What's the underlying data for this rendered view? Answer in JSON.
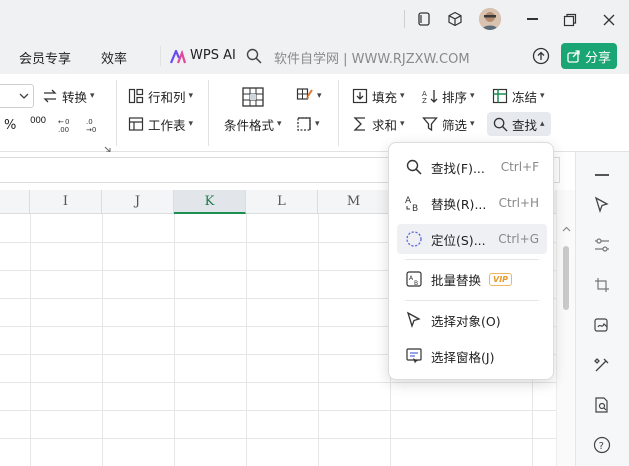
{
  "menubar": {
    "member": "会员专享",
    "efficiency": "效率",
    "wps_ai": "WPS AI",
    "search_text": "软件自学网 | WWW.RJZXW.COM",
    "share": "分享"
  },
  "ribbon": {
    "convert": "转换",
    "row_col": "行和列",
    "worksheet": "工作表",
    "cond_format": "条件格式",
    "fill": "填充",
    "sort": "排序",
    "freeze": "冻结",
    "sum": "求和",
    "filter": "筛选",
    "find": "查找",
    "percent": "%",
    "thousands": "000"
  },
  "columns": [
    "I",
    "J",
    "K",
    "L",
    "M"
  ],
  "selected_column": "K",
  "dropdown": {
    "items": [
      {
        "label": "查找(F)...",
        "shortcut": "Ctrl+F"
      },
      {
        "label": "替换(R)...",
        "shortcut": "Ctrl+H"
      },
      {
        "label": "定位(S)...",
        "shortcut": "Ctrl+G"
      },
      {
        "label": "批量替换",
        "badge": "VIP"
      },
      {
        "label": "选择对象(O)"
      },
      {
        "label": "选择窗格(J)"
      }
    ]
  },
  "colors": {
    "accent": "#1e8f52",
    "share_bg": "#1aa574",
    "titlebar_bg": "#f0f1f3"
  }
}
